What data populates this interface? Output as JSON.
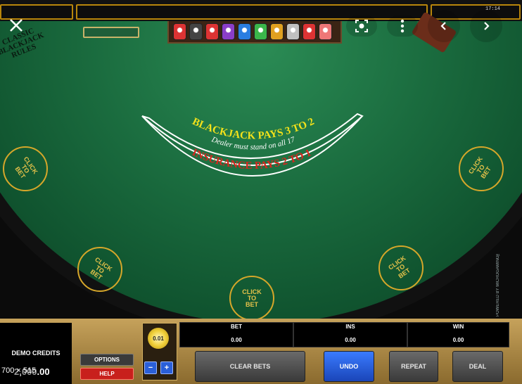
{
  "topbar": {
    "clock": "17:14"
  },
  "rules_badge": {
    "line1": "CLASSIC",
    "line2": "BLACKJACK",
    "line3": "RULES"
  },
  "table_text": {
    "blackjack_pays": "BLACKJACK PAYS 3 TO 2",
    "dealer_rule": "Dealer must stand on all 17",
    "insurance": "INSURANCE PAYS 2 TO 1",
    "powered_by": "POWERED BY MICROGAMING™"
  },
  "bet_spots": [
    {
      "label": "CLICK\nTO\nBET"
    },
    {
      "label": "CLICK\nTO\nBET"
    },
    {
      "label": "CLICK\nTO\nBET"
    },
    {
      "label": "CLICK\nTO\nBET"
    },
    {
      "label": "CLICK\nTO\nBET"
    }
  ],
  "credits": {
    "title": "DEMO CREDITS",
    "value": "2,000.00"
  },
  "dimension_overlay": "700 × 515",
  "buttons": {
    "options": "OPTIONS",
    "help": "HELP",
    "minus": "−",
    "plus": "+",
    "clear_bets": "CLEAR BETS",
    "undo": "UNDO",
    "repeat": "REPEAT",
    "deal": "DEAL"
  },
  "chip_value": "0.01",
  "stats": {
    "bet": {
      "label": "BET",
      "value": "0.00"
    },
    "ins": {
      "label": "INS",
      "value": "0.00"
    },
    "win": {
      "label": "WIN",
      "value": "0.00"
    }
  },
  "colors": {
    "felt": "#1a6b3e",
    "gold": "#d6a72a",
    "yellow_text": "#f3e21a",
    "red_text": "#d8261e",
    "undo_blue": "#1f57d6",
    "help_red": "#c8201c"
  },
  "rack_chip_colors": [
    "#d33",
    "#444",
    "#d33",
    "#8a3ec8",
    "#2a7de1",
    "#3bb54a",
    "#e0a020",
    "#c0c0c0",
    "#d33",
    "#e77"
  ]
}
